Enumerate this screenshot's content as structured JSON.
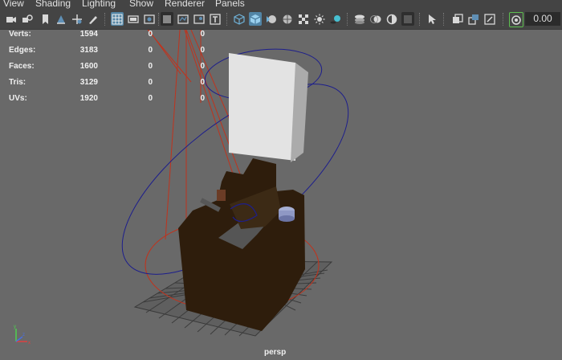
{
  "menu": {
    "items": [
      "View",
      "Shading",
      "Lighting",
      "Show",
      "Renderer",
      "Panels"
    ]
  },
  "toolbar": {
    "icons": [
      "camera-select-icon",
      "camera-attributes-icon",
      "bookmark-icon",
      "image-plane-icon",
      "2d-pan-zoom-icon",
      "grease-pencil-icon",
      "grid-icon",
      "film-gate-icon",
      "resolution-gate-icon",
      "gate-mask-icon",
      "field-chart-icon",
      "safe-action-icon",
      "safe-title-icon",
      "wireframe-icon",
      "smooth-shade-icon",
      "default-material-icon",
      "shaded-wireframe-icon",
      "texture-icon",
      "lights-icon",
      "shadows-icon",
      "screen-space-ao-icon",
      "motion-blur-icon",
      "anti-aliasing-icon",
      "depth-of-field-icon",
      "isolate-select-icon",
      "xray-icon",
      "xray-active-icon",
      "xray-joints-icon",
      "hud-icon"
    ],
    "time_value": "0.00"
  },
  "hud": {
    "rows": [
      {
        "label": "Verts:",
        "v1": "1594",
        "v2": "0",
        "v3": "0"
      },
      {
        "label": "Edges:",
        "v1": "3183",
        "v2": "0",
        "v3": "0"
      },
      {
        "label": "Faces:",
        "v1": "1600",
        "v2": "0",
        "v3": "0"
      },
      {
        "label": "Tris:",
        "v1": "3129",
        "v2": "0",
        "v3": "0"
      },
      {
        "label": "UVs:",
        "v1": "1920",
        "v2": "0",
        "v3": "0"
      }
    ]
  },
  "viewport": {
    "camera_label": "persp",
    "colors": {
      "background": "#696969",
      "light_guides": "#c0331d",
      "selection_curves": "#1d1e8c",
      "model_body": "#2e1d0c",
      "card": "#e3e3e3"
    }
  },
  "axis": {
    "x_label": "x",
    "y_label": "y",
    "z_label": "z"
  }
}
